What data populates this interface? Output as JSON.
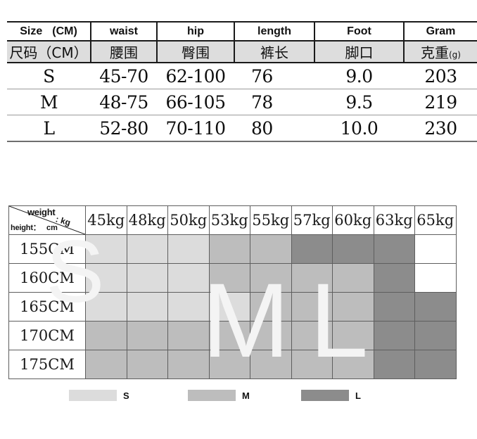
{
  "spec_table": {
    "headers_en": [
      "Size",
      "waist",
      "hip",
      "length",
      "Foot",
      "Gram"
    ],
    "header_size_unit_en": "(CM)",
    "headers_cn": [
      "尺码（CM）",
      "腰围",
      "臀围",
      "裤长",
      "脚口",
      "克重"
    ],
    "gram_unit_cn": "(g)",
    "rows": [
      {
        "size": "S",
        "waist": "45-70",
        "hip": "62-100",
        "length": "76",
        "foot": "9.0",
        "gram": "203"
      },
      {
        "size": "M",
        "waist": "48-75",
        "hip": "66-105",
        "length": "78",
        "foot": "9.5",
        "gram": "219"
      },
      {
        "size": "L",
        "waist": "52-80",
        "hip": "70-110",
        "length": "80",
        "foot": "10.0",
        "gram": "230"
      }
    ]
  },
  "matrix": {
    "corner": {
      "weight_label": "weight",
      "weight_unit": ": kg",
      "height_label": "height：",
      "height_unit": "cm"
    },
    "weight_columns": [
      "45kg",
      "48kg",
      "50kg",
      "53kg",
      "55kg",
      "57kg",
      "60kg",
      "63kg",
      "65kg"
    ],
    "height_rows": [
      "155CM",
      "160CM",
      "165CM",
      "170CM",
      "175CM"
    ],
    "cells": [
      [
        "S",
        "S",
        "S",
        "M",
        "M",
        "L",
        "L",
        "L",
        ""
      ],
      [
        "S",
        "S",
        "S",
        "M",
        "M",
        "M",
        "M",
        "L",
        ""
      ],
      [
        "S",
        "S",
        "S",
        "S",
        "M",
        "M",
        "M",
        "L",
        "L"
      ],
      [
        "M",
        "M",
        "M",
        "M",
        "M",
        "M",
        "M",
        "L",
        "L"
      ],
      [
        "M",
        "M",
        "M",
        "M",
        "M",
        "M",
        "M",
        "L",
        "L"
      ]
    ],
    "watermarks": [
      "S",
      "M",
      "L"
    ]
  },
  "legend": {
    "items": [
      {
        "label": "S",
        "color": "#dcdcdc"
      },
      {
        "label": "M",
        "color": "#bdbdbd"
      },
      {
        "label": "L",
        "color": "#8c8c8c"
      }
    ]
  },
  "colors": {
    "size_s": "#dcdcdc",
    "size_m": "#bdbdbd",
    "size_l": "#8c8c8c",
    "empty": "#ffffff",
    "header_cn_bg": "#dddddd",
    "grid_line": "#5e5e5e",
    "spec_border": "#1a1a1a",
    "watermark": "#f4f4f4"
  }
}
